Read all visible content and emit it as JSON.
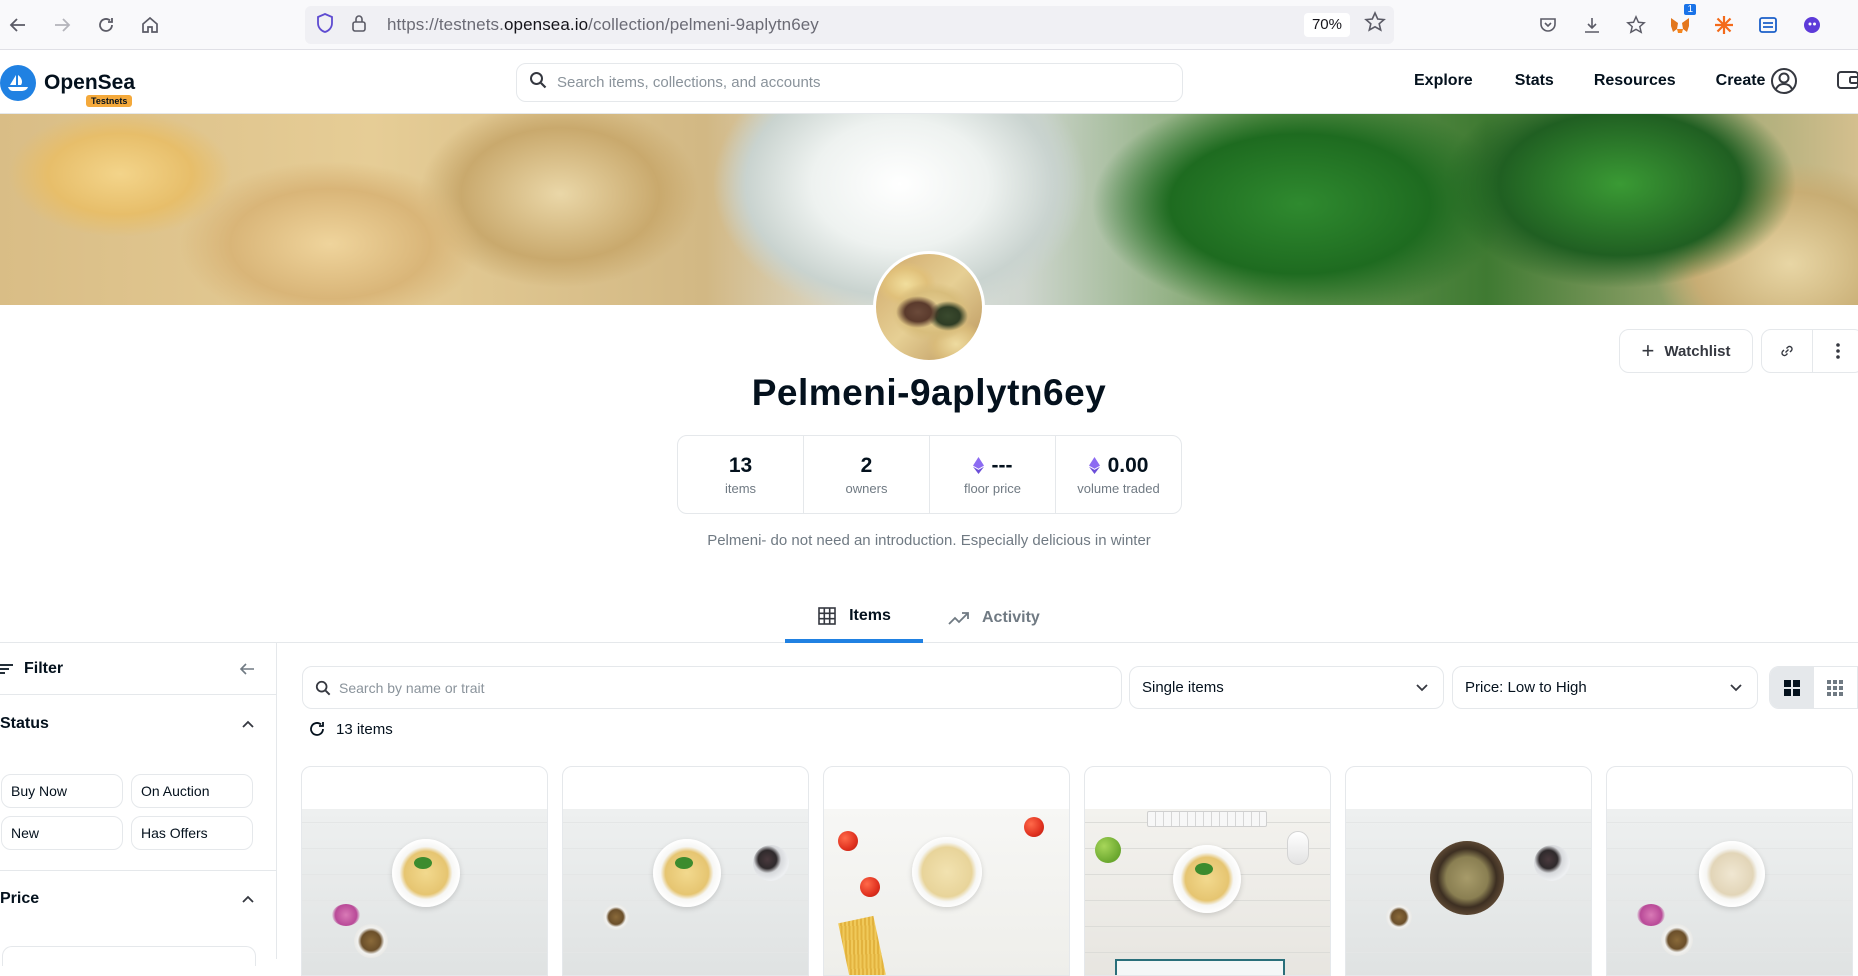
{
  "browser": {
    "url_prefix": "https://testnets.",
    "url_domain": "opensea.io",
    "url_path": "/collection/pelmeni-9aplytn6ey",
    "zoom": "70%",
    "extension_badge": "1"
  },
  "site": {
    "logo_text": "OpenSea",
    "testnets_label": "Testnets",
    "search_placeholder": "Search items, collections, and accounts",
    "nav": [
      "Explore",
      "Stats",
      "Resources",
      "Create"
    ]
  },
  "collection": {
    "name": "Pelmeni-9aplytn6ey",
    "watchlist_label": "Watchlist",
    "stats": [
      {
        "value": "13",
        "label": "items",
        "eth": false
      },
      {
        "value": "2",
        "label": "owners",
        "eth": false
      },
      {
        "value": "---",
        "label": "floor price",
        "eth": true
      },
      {
        "value": "0.00",
        "label": "volume traded",
        "eth": true
      }
    ],
    "description": "Pelmeni- do not need an introduction. Especially delicious in winter"
  },
  "tabs": [
    {
      "label": "Items",
      "active": true,
      "icon": "grid-icon"
    },
    {
      "label": "Activity",
      "active": false,
      "icon": "activity-chart-icon"
    }
  ],
  "sidebar": {
    "filter_label": "Filter",
    "status_label": "Status",
    "status_options": [
      "Buy Now",
      "On Auction",
      "New",
      "Has Offers"
    ],
    "price_label": "Price"
  },
  "items_toolbar": {
    "search_placeholder": "Search by name or trait",
    "type_select": "Single items",
    "sort_select": "Price: Low to High",
    "count_text": "13 items"
  },
  "colors": {
    "accent": "#2081e2",
    "text": "#04111d",
    "muted": "#707a83",
    "border": "#e5e8eb",
    "eth": "#6c5ce7"
  }
}
